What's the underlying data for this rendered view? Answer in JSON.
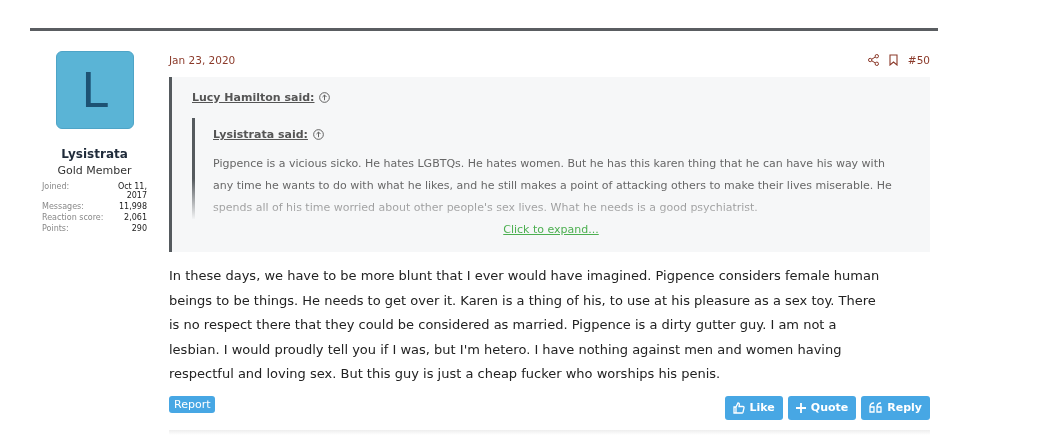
{
  "post": {
    "author": {
      "avatar_letter": "L",
      "name": "Lysistrata",
      "title": "Gold Member",
      "stats": [
        {
          "label": "Joined:",
          "value": "Oct 11, 2017"
        },
        {
          "label": "Messages:",
          "value": "11,998"
        },
        {
          "label": "Reaction score:",
          "value": "2,061"
        },
        {
          "label": "Points:",
          "value": "290"
        }
      ]
    },
    "date": "Jan 23, 2020",
    "number": "#50",
    "quote": {
      "author": "Lucy Hamilton said:",
      "nested_quote": {
        "author": "Lysistrata said:",
        "text": "Pigpence is a vicious sicko. He hates LGBTQs. He hates women. But he has this karen thing that he can have his way with any time he wants to do with what he likes, and he still makes a point of attacking others to make their lives miserable. He spends all of his time worried about other people's sex lives. What he needs is a good psychiatrist."
      },
      "expand_link": "Click to expand..."
    },
    "body": "In these days, we have to be more blunt that I ever would have imagined. Pigpence considers female human beings to be things. He needs to get over it. Karen is a thing of his, to use at his pleasure as a sex toy. There is no respect there that they could be considered as married. Pigpence is a dirty gutter guy. I am not a lesbian. I would proudly tell you if I was, but I'm hetero. I have nothing against men and women having respectful and loving sex. But this guy is just a cheap fucker who worships his penis.",
    "report": "Report",
    "actions": [
      {
        "kind": "like",
        "label": "Like"
      },
      {
        "kind": "quote",
        "label": "Quote"
      },
      {
        "kind": "reply",
        "label": "Reply"
      }
    ]
  }
}
